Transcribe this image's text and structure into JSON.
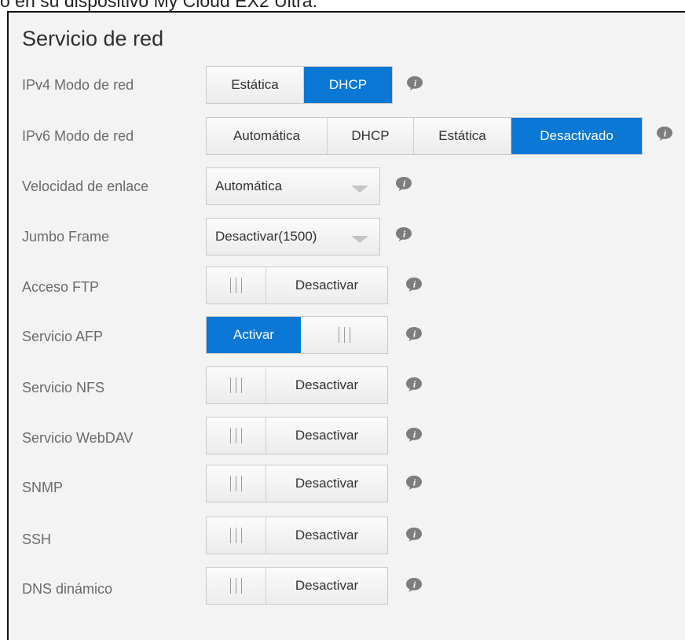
{
  "caption": "o en su dispositivo My Cloud EX2 Ultra.",
  "section": {
    "title": "Servicio de red"
  },
  "ipv4": {
    "label": "IPv4 Modo de red",
    "options": [
      "Estática",
      "DHCP"
    ],
    "selected": "DHCP"
  },
  "ipv6": {
    "label": "IPv6 Modo de red",
    "options": [
      "Automática",
      "DHCP",
      "Estática",
      "Desactivado"
    ],
    "selected": "Desactivado"
  },
  "link_speed": {
    "label": "Velocidad de enlace",
    "value": "Automática"
  },
  "jumbo": {
    "label": "Jumbo Frame",
    "value": "Desactivar(1500)"
  },
  "toggles": [
    {
      "label": "Acceso FTP",
      "state": "Desactivar",
      "on": false
    },
    {
      "label": "Servicio AFP",
      "state": "Activar",
      "on": true
    },
    {
      "label": "Servicio NFS",
      "state": "Desactivar",
      "on": false
    },
    {
      "label": "Servicio WebDAV",
      "state": "Desactivar",
      "on": false
    },
    {
      "label": "SNMP",
      "state": "Desactivar",
      "on": false
    },
    {
      "label": "SSH",
      "state": "Desactivar",
      "on": false
    },
    {
      "label": "DNS dinámico",
      "state": "Desactivar",
      "on": false
    }
  ],
  "colors": {
    "accent": "#0a78d4",
    "info_icon": "#7d7d7d"
  },
  "icons": {
    "info": "info-icon"
  }
}
